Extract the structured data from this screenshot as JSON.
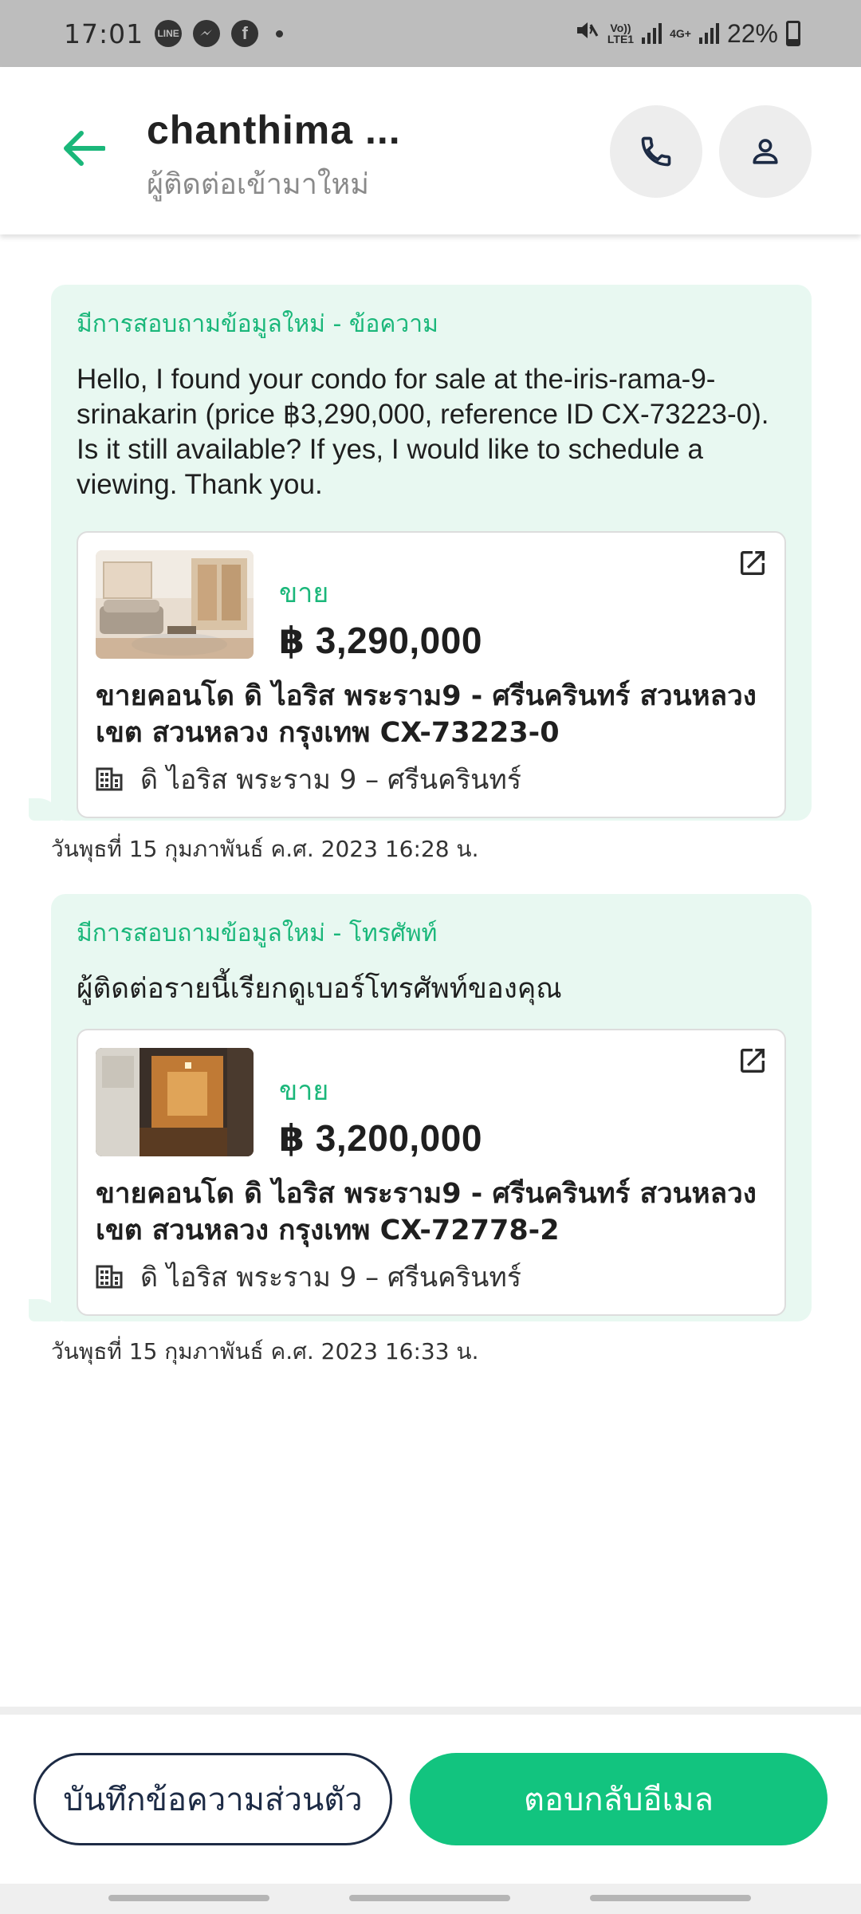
{
  "status_bar": {
    "time": "17:01",
    "apps": [
      "LINE",
      "messenger-icon",
      "facebook-icon"
    ],
    "signal1_label": "Vo))\nLTE1",
    "signal2_label": "4G+",
    "battery": "22%"
  },
  "header": {
    "title": "chanthima ...",
    "subtitle": "ผู้ติดต่อเข้ามาใหม่",
    "accent_color": "#1ab77a"
  },
  "messages": [
    {
      "heading": "มีการสอบถามข้อมูลใหม่ - ข้อความ",
      "body": "Hello, I found your condo for sale at the-iris-rama-9-srinakarin (price ฿3,290,000, reference ID CX-73223-0). Is it still available? If yes, I would like to schedule a viewing. Thank you.",
      "card": {
        "tag": "ขาย",
        "price": "฿ 3,290,000",
        "title": "ขายคอนโด  ดิ ไอริส พระราม9 - ศรีนครินทร์ สวนหลวง เขต สวนหลวง กรุงเทพ CX-73223-0",
        "project": "ดิ ไอริส พระราม 9 – ศรีนครินทร์"
      },
      "timestamp": "วันพุธที่ 15 กุมภาพันธ์ ค.ศ. 2023 16:28 น."
    },
    {
      "heading": "มีการสอบถามข้อมูลใหม่ - โทรศัพท์",
      "body": "ผู้ติดต่อรายนี้เรียกดูเบอร์โทรศัพท์ของคุณ",
      "card": {
        "tag": "ขาย",
        "price": "฿ 3,200,000",
        "title": "ขายคอนโด  ดิ ไอริส พระราม9 - ศรีนครินทร์ สวนหลวง เขต สวนหลวง กรุงเทพ CX-72778-2",
        "project": "ดิ ไอริส พระราม 9 – ศรีนครินทร์"
      },
      "timestamp": "วันพุธที่ 15 กุมภาพันธ์ ค.ศ. 2023 16:33 น."
    }
  ],
  "actions": {
    "private_note": "บันทึกข้อความส่วนตัว",
    "reply_email": "ตอบกลับอีเมล"
  }
}
